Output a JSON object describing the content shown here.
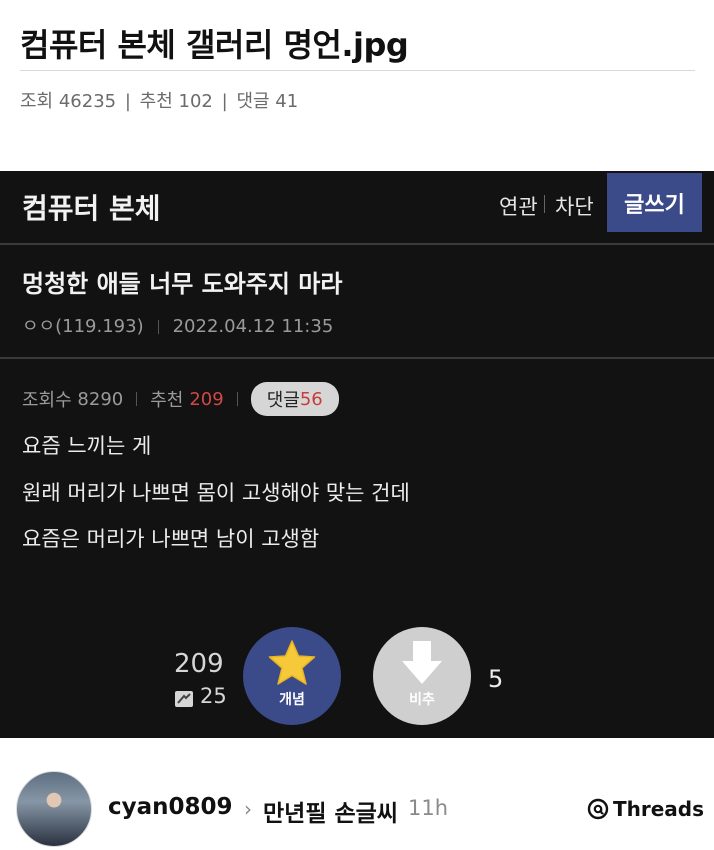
{
  "post": {
    "title": "컴퓨터 본체 갤러리 명언.jpg",
    "views_label": "조회",
    "views": "46235",
    "recommend_label": "추천",
    "recommend": "102",
    "comments_label": "댓글",
    "comments": "41"
  },
  "screenshot": {
    "gallery_name": "컴퓨터 본체",
    "related_label": "연관",
    "block_label": "차단",
    "write_label": "글쓰기",
    "article_title": "멍청한 애들 너무 도와주지 마라",
    "author": "ㅇㅇ(119.193)",
    "date": "2022.04.12 11:35",
    "views_label": "조회수",
    "views": "8290",
    "recommend_label": "추천",
    "recommend": "209",
    "comments_label": "댓글",
    "comments": "56",
    "body_lines": [
      "요즘 느끼는 게",
      "원래 머리가 나쁘면 몸이 고생해야 맞는 건데",
      "요즘은 머리가 나쁘면 남이 고생함"
    ],
    "recommend_count": "209",
    "fixed_recommend_count": "25",
    "recommend_button_label": "개념",
    "nonrecommend_button_label": "비추",
    "nonrecommend_count": "5",
    "colors": {
      "accent": "#3b4a88",
      "highlight": "#d04848",
      "background": "#121212"
    }
  },
  "footer": {
    "username": "cyan0809",
    "board_name": "만년필 손글씨",
    "time_ago": "11h",
    "app_label": "Threads"
  },
  "icons": [
    "star-icon",
    "down-arrow-icon",
    "fixed-recommend-icon",
    "chevron-right-icon",
    "threads-logo-icon"
  ]
}
